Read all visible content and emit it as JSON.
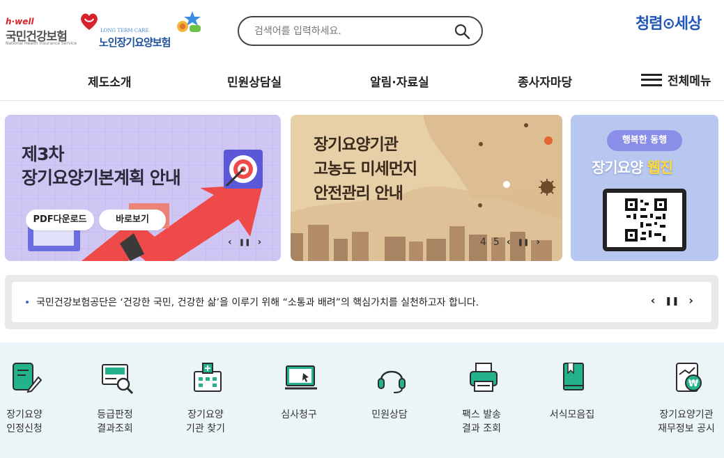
{
  "header": {
    "nhis_logo": {
      "hwell": "h·well",
      "name": "국민건강보험",
      "eng": "National Health Insurance Service"
    },
    "ltc_logo": {
      "eng": "LONG TERM CARE",
      "name": "노인장기요양보험"
    },
    "search": {
      "placeholder": "검색어를 입력하세요."
    },
    "clean_logo": "청렴⊙세상"
  },
  "nav": {
    "items": [
      "제도소개",
      "민원상담실",
      "알림·자료실",
      "종사자마당"
    ],
    "all_menu": "전체메뉴"
  },
  "banners": [
    {
      "title_line1": "제3차",
      "title_line2": "장기요양기본계획 안내",
      "button1": "PDF다운로드",
      "button2": "바로보기",
      "prev": "‹",
      "pause": "❚❚",
      "next": "›"
    },
    {
      "title_line1": "장기요양기관",
      "title_line2": "고농도 미세먼지",
      "title_line3": "안전관리 안내",
      "page_current": "4",
      "page_next": "5",
      "prev": "‹",
      "pause": "❚❚",
      "next": "›"
    },
    {
      "chip": "행복한 동행",
      "title_main": "장기요양",
      "title_highlight": "웹진"
    }
  ],
  "notice": {
    "text": "국민건강보험공단은 ‘건강한 국민, 건강한 삶’을 이루기 위해 “소통과 배려”의 핵심가치를 실천하고자 합니다.",
    "prev": "‹",
    "pause": "❚❚",
    "next": "›"
  },
  "quick_menu": [
    {
      "label": "장기요양\n인정신청",
      "icon": "application-form-icon"
    },
    {
      "label": "등급판정\n결과조회",
      "icon": "grade-search-icon"
    },
    {
      "label": "장기요양\n기관 찾기",
      "icon": "facility-search-icon"
    },
    {
      "label": "심사청구",
      "icon": "claim-review-icon"
    },
    {
      "label": "민원상담",
      "icon": "headset-icon"
    },
    {
      "label": "팩스 발송\n결과 조회",
      "icon": "fax-icon"
    },
    {
      "label": "서식모음집",
      "icon": "forms-book-icon"
    },
    {
      "label": "장기요양기관\n재무정보 공시",
      "icon": "finance-report-icon"
    }
  ],
  "colors": {
    "accent_green": "#23b28c",
    "dark": "#2b2b2b",
    "quick_bg": "#ebf4f7",
    "banner1_bg": "#cfc6f4",
    "banner2_bg": "#e7cfa8",
    "banner3_bg": "#b7c7ef"
  }
}
